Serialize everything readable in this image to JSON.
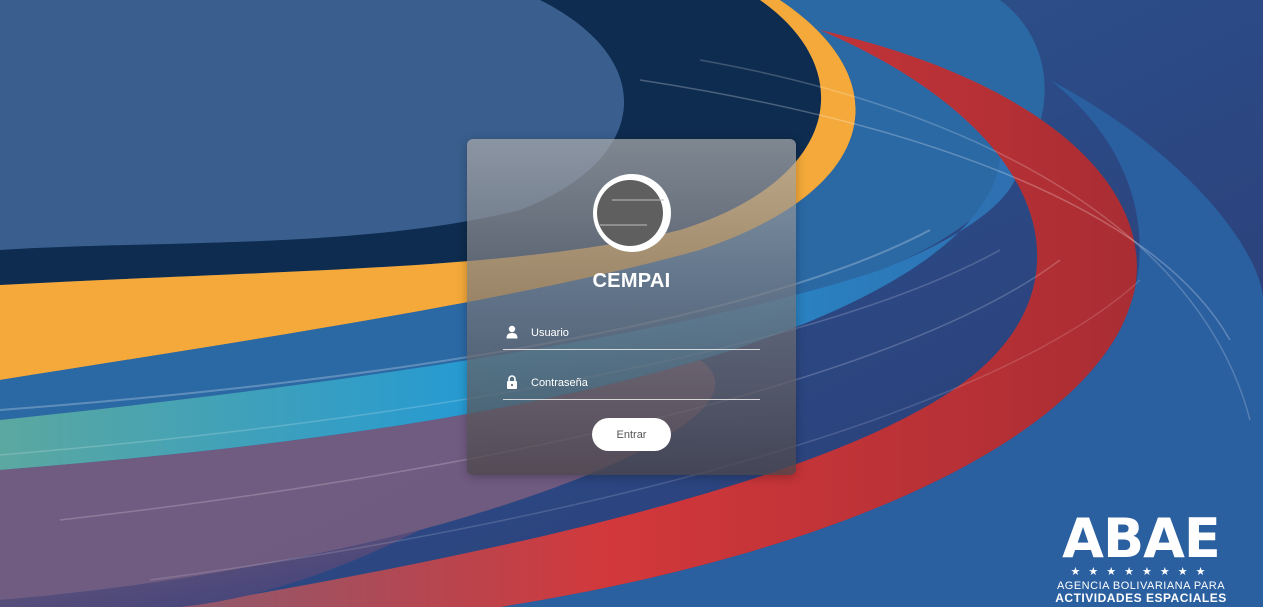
{
  "login": {
    "app_title": "CEMPAI",
    "username_placeholder": "Usuario",
    "password_placeholder": "Contraseña",
    "submit_label": "Entrar"
  },
  "footer_logo": {
    "brand": "ABAE",
    "stars": "★★★★★★★★",
    "line1": "AGENCIA BOLIVARIANA PARA",
    "line2": "ACTIVIDADES ESPACIALES"
  },
  "colors": {
    "background_navy": "#2a3f78",
    "band_orange": "#f4a93a",
    "band_red": "#c93537",
    "band_blue": "#2f86c4",
    "button_bg": "#ffffff"
  },
  "icons": [
    "user-icon",
    "lock-icon"
  ]
}
